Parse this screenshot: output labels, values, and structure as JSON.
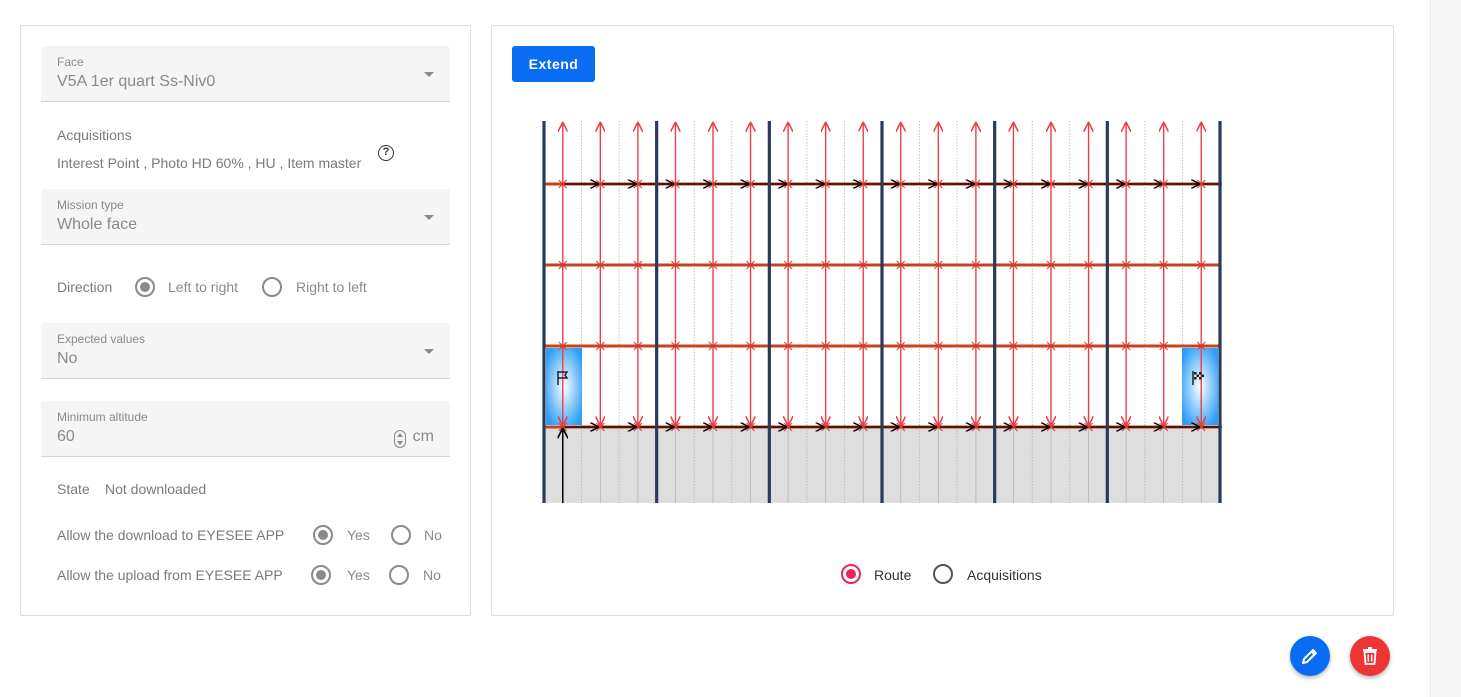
{
  "left": {
    "face": {
      "label": "Face",
      "value": "V5A 1er quart Ss-Niv0"
    },
    "acquisitions": {
      "label": "Acquisitions",
      "value": "Interest Point , Photo HD 60% , HU , Item master"
    },
    "mission_type": {
      "label": "Mission type",
      "value": "Whole face"
    },
    "direction": {
      "label": "Direction",
      "options": [
        "Left to right",
        "Right to left"
      ],
      "selected": "Left to right"
    },
    "expected_values": {
      "label": "Expected values",
      "value": "No"
    },
    "minimum_altitude": {
      "label": "Minimum altitude",
      "value": "60",
      "unit": "cm"
    },
    "state": {
      "label": "State",
      "value": "Not downloaded"
    },
    "allow_download": {
      "label": "Allow the download to EYESEE APP",
      "options": [
        "Yes",
        "No"
      ],
      "selected": "Yes"
    },
    "allow_upload": {
      "label": "Allow the upload from EYESEE APP",
      "options": [
        "Yes",
        "No"
      ],
      "selected": "Yes"
    }
  },
  "right": {
    "extend_label": "Extend",
    "view": {
      "options": [
        "Route",
        "Acquisitions"
      ],
      "selected": "Route"
    }
  },
  "colors": {
    "accent": "#0a6cf2",
    "route_red": "#e8404a",
    "beam_orange": "#c8421f",
    "upright_navy": "#2a3a5a",
    "radio_pink": "#e8285a",
    "delete_red": "#ee3535"
  },
  "icons": {
    "help": "help-circle-icon",
    "start": "flag-icon",
    "finish": "checkered-flag-icon",
    "edit": "pencil-icon",
    "delete": "trash-icon"
  }
}
